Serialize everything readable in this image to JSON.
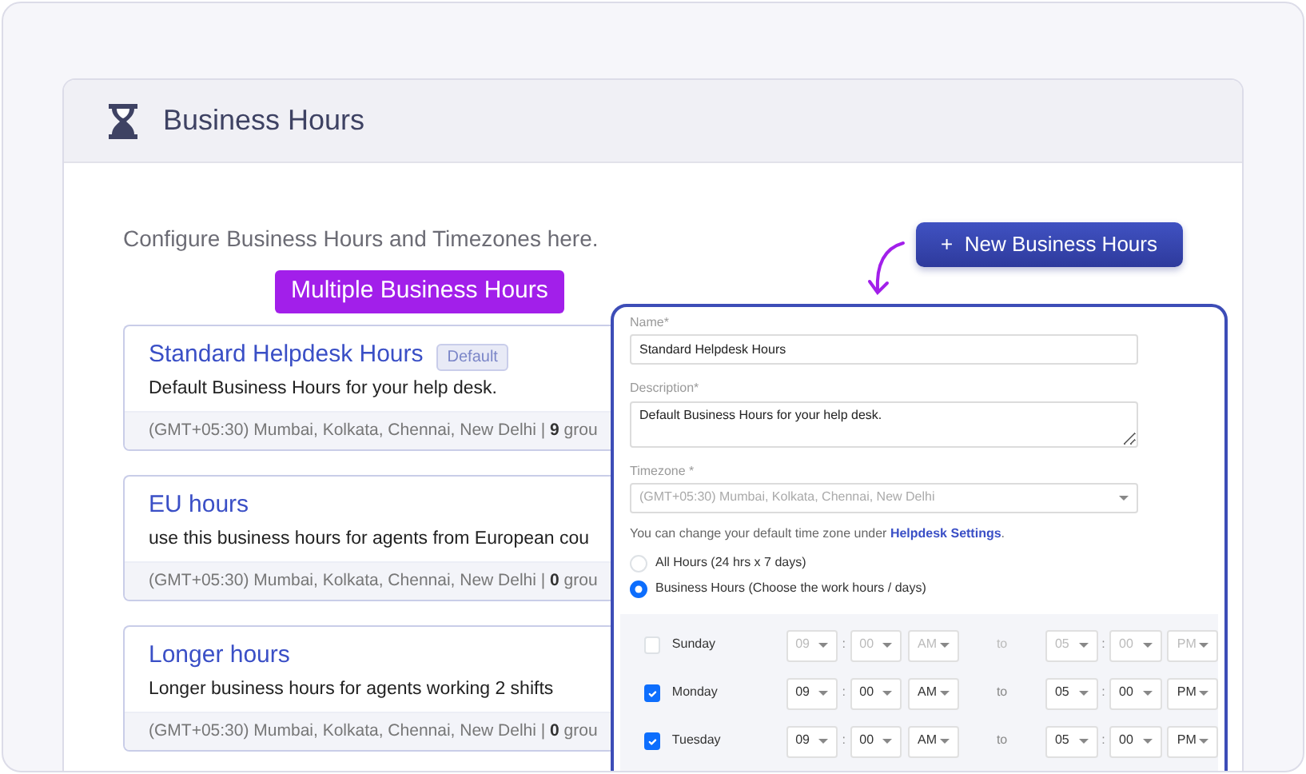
{
  "header": {
    "title": "Business Hours"
  },
  "intro": "Configure Business Hours and Timezones here.",
  "new_button": {
    "icon": "+",
    "label": "New Business Hours"
  },
  "callout": "Multiple Business Hours",
  "business_hours": [
    {
      "title": "Standard Helpdesk Hours",
      "badge": "Default",
      "description": "Default Business Hours for your help desk.",
      "footer": "(GMT+05:30) Mumbai, Kolkata, Chennai, New Delhi | **9** grou"
    },
    {
      "title": "EU hours",
      "description": "use this business hours for agents from European cou",
      "footer": "(GMT+05:30) Mumbai, Kolkata, Chennai, New Delhi | **0** grou"
    },
    {
      "title": "Longer hours",
      "description": "Longer business hours for agents working 2 shifts",
      "footer": "(GMT+05:30) Mumbai, Kolkata, Chennai, New Delhi | **0** grou"
    }
  ],
  "form": {
    "name_label": "Name*",
    "name_value": "Standard Helpdesk Hours",
    "description_label": "Description*",
    "description_value": "Default Business Hours for your help desk.",
    "timezone_label": "Timezone *",
    "timezone_value": "(GMT+05:30) Mumbai, Kolkata, Chennai, New Delhi",
    "timezone_disabled": true,
    "hint": "You can change your default time zone under ",
    "hint_link": "Helpdesk Settings",
    "hint_end": ".",
    "options": [
      {
        "label": "All Hours (24 hrs x 7 days)",
        "selected": false
      },
      {
        "label": "Business Hours (Choose the work hours / days)",
        "selected": true
      }
    ],
    "schedule": [
      {
        "day": "Sunday",
        "checked": false,
        "separator": ":",
        "from": [
          "09",
          "00",
          "AM"
        ],
        "to_label": "to",
        "to": [
          "05",
          "00",
          "PM"
        ]
      },
      {
        "day": "Monday",
        "checked": true,
        "separator": ":",
        "from": [
          "09",
          "00",
          "AM"
        ],
        "to_label": "to",
        "to": [
          "05",
          "00",
          "PM"
        ]
      },
      {
        "day": "Tuesday",
        "checked": true,
        "separator": ":",
        "from": [
          "09",
          "00",
          "AM"
        ],
        "to_label": "to",
        "to": [
          "05",
          "00",
          "PM"
        ]
      }
    ]
  }
}
